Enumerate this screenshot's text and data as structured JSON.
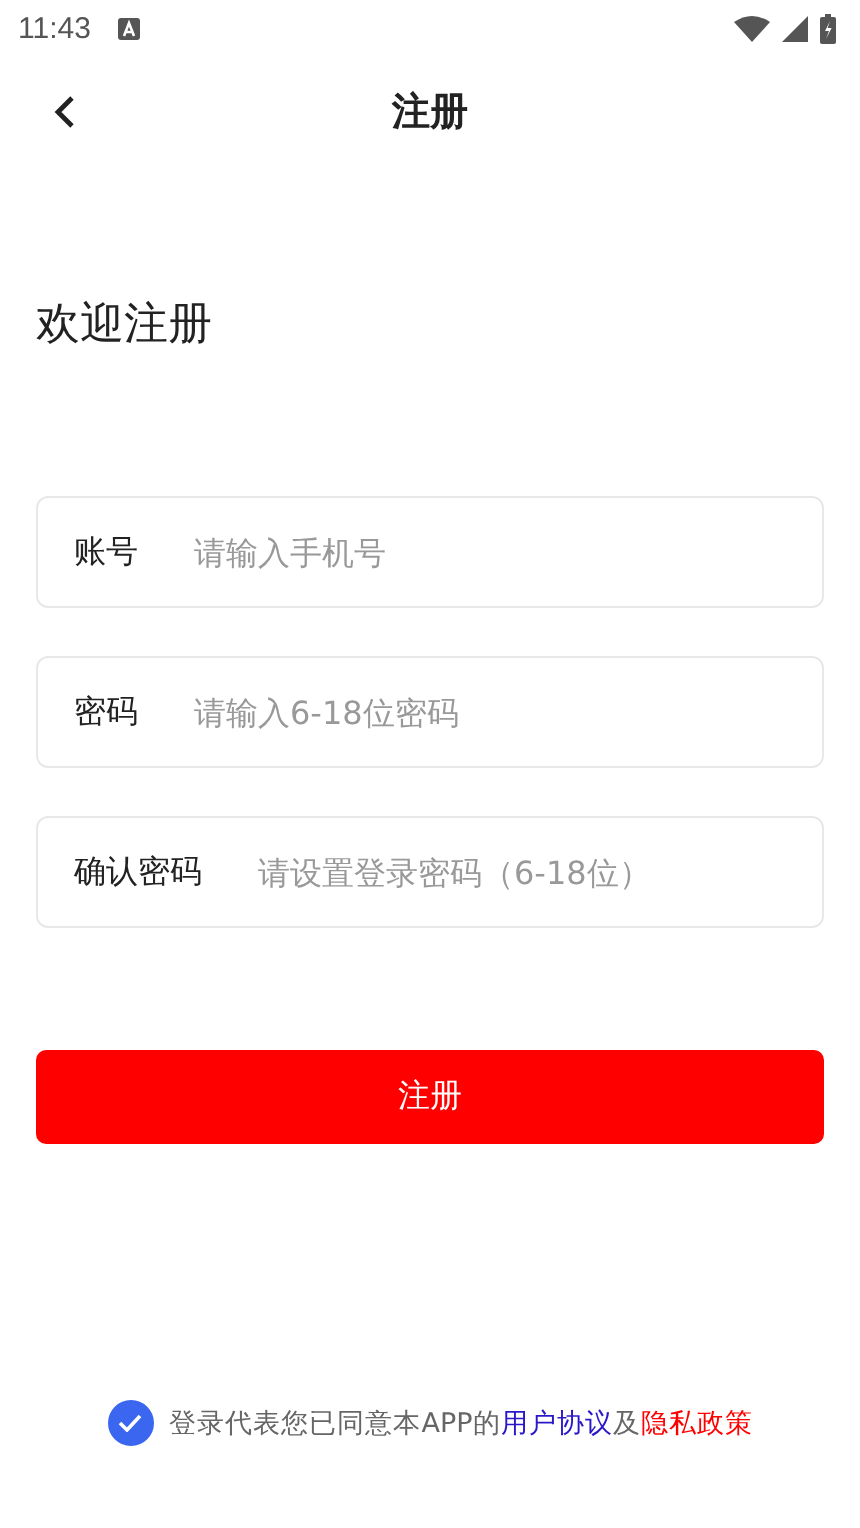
{
  "status_bar": {
    "time": "11:43"
  },
  "nav": {
    "title": "注册"
  },
  "heading": "欢迎注册",
  "fields": [
    {
      "label": "账号",
      "placeholder": "请输入手机号"
    },
    {
      "label": "密码",
      "placeholder": "请输入6-18位密码"
    },
    {
      "label": "确认密码",
      "placeholder": "请设置登录密码（6-18位）"
    }
  ],
  "submit": "注册",
  "agreement": {
    "checked": true,
    "text": "登录代表您已同意本APP的",
    "link_1": "用户协议",
    "joiner": "及",
    "link_2": "隐私政策"
  }
}
